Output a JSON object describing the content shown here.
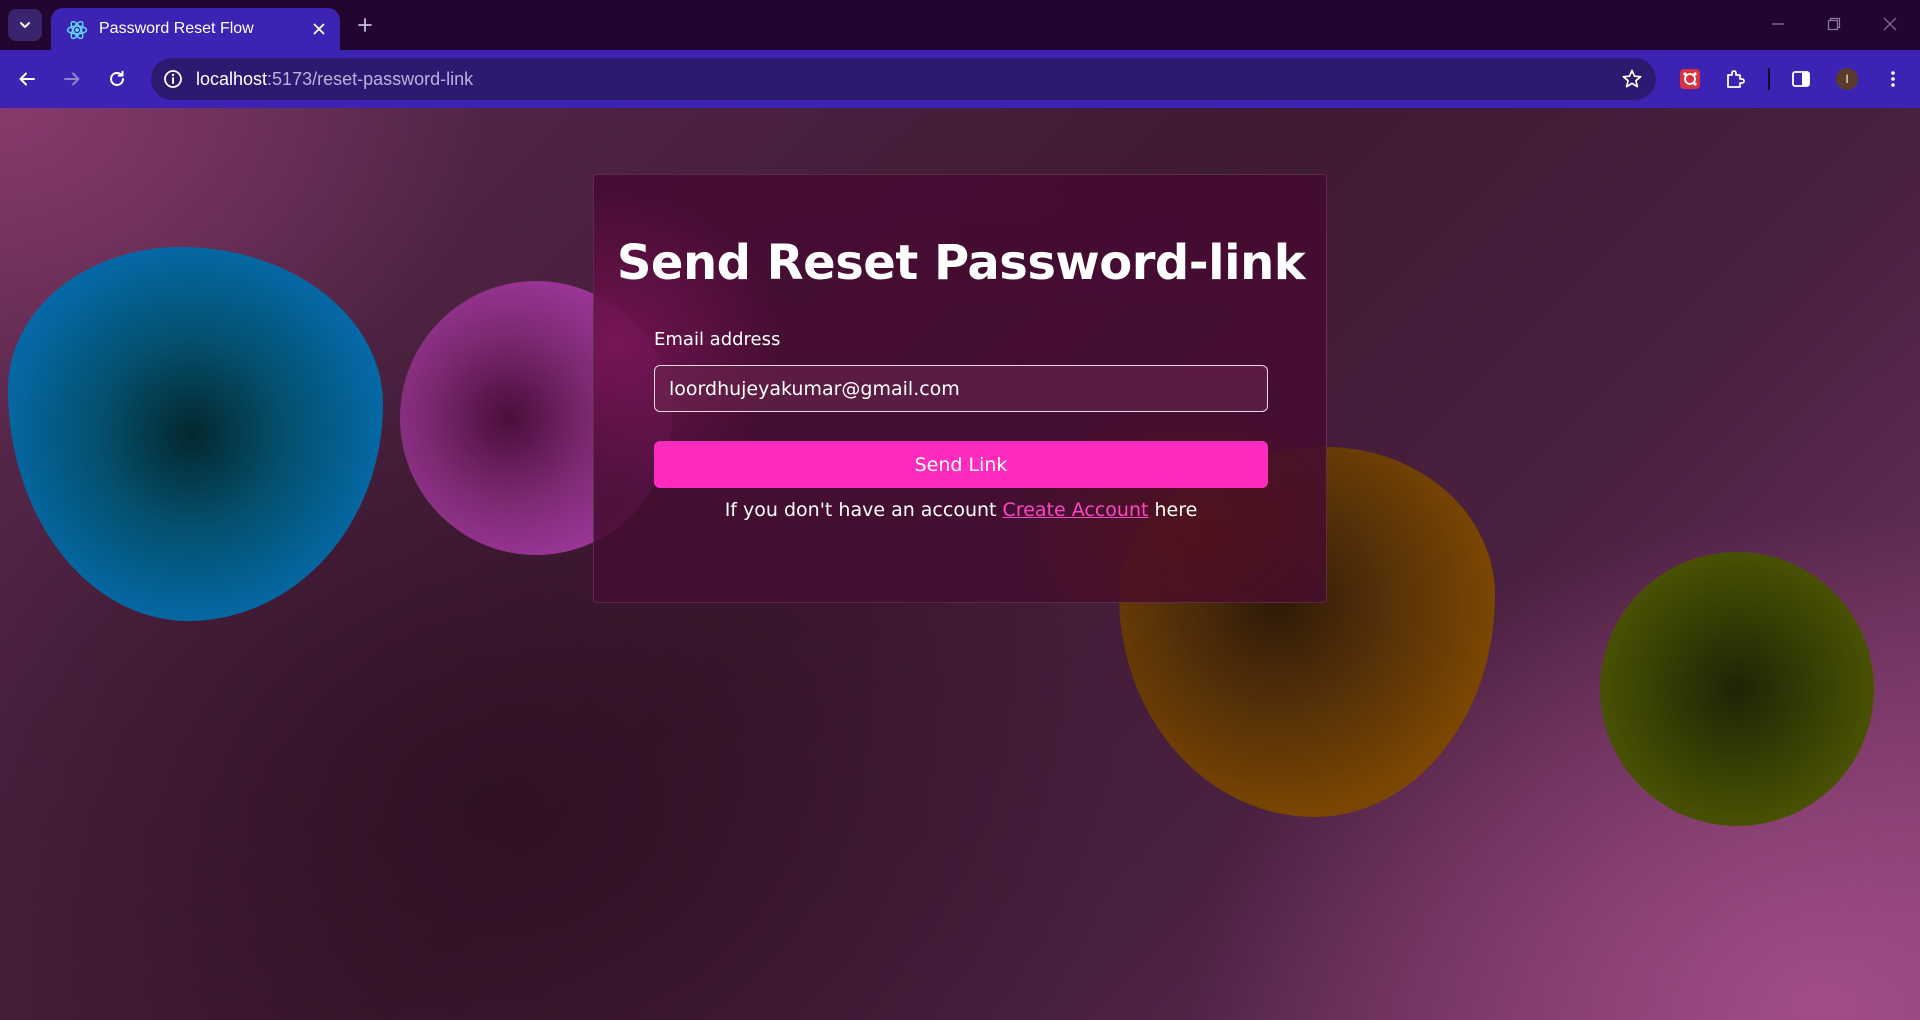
{
  "browser": {
    "tab_title": "Password Reset Flow",
    "url_host": "localhost",
    "url_rest": ":5173/reset-password-link",
    "profile_initial": "I"
  },
  "page": {
    "title": "Send Reset Password-link",
    "email_label": "Email address",
    "email_value": "loordhujeyakumar@gmail.com",
    "submit_label": "Send Link",
    "signup_prefix": "If you don't have an account",
    "signup_link": "Create Account",
    "signup_suffix": "here"
  },
  "colors": {
    "accent": "#ff2bbf",
    "tab_bar": "#22062f",
    "toolbar": "#3d23b3"
  }
}
